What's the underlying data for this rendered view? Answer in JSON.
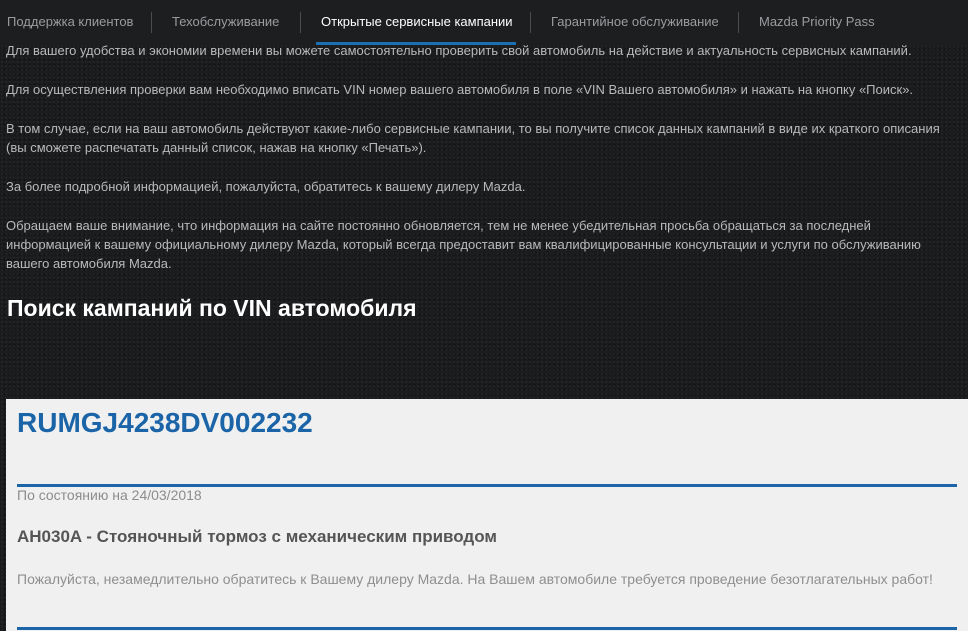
{
  "nav": {
    "tabs": [
      {
        "label": "Поддержка клиентов"
      },
      {
        "label": "Техобслуживание"
      },
      {
        "label": "Открытые сервисные кампании"
      },
      {
        "label": "Гарантийное обслуживание"
      },
      {
        "label": "Mazda Priority Pass"
      }
    ],
    "active_index": 2
  },
  "intro": {
    "paragraphs": [
      "Для вашего удобства и экономии времени вы можете самостоятельно проверить свой автомобиль на действие и актуальность сервисных кампаний.",
      "Для осуществления проверки вам необходимо вписать VIN номер вашего автомобиля в поле «VIN Вашего автомобиля» и нажать на кнопку «Поиск».",
      "В том случае, если на ваш автомобиль действуют какие-либо сервисные кампании, то вы получите список данных кампаний в виде их краткого описания (вы сможете распечатать данный список, нажав на кнопку «Печать»).",
      "За более подробной информацией, пожалуйста, обратитесь к вашему дилеру Mazda.",
      "Обращаем ваше внимание, что информация на сайте постоянно обновляется, тем не менее убедительная просьба обращаться за последней информацией к вашему официальному дилеру Mazda, который всегда предоставит вам квалифицированные консультации и услуги по обслуживанию вашего автомобиля Mazda."
    ]
  },
  "search": {
    "title": "Поиск кампаний по VIN автомобиля"
  },
  "result": {
    "vin": "RUMGJ4238DV002232",
    "status": "По состоянию на 24/03/2018",
    "campaign_title": "AH030A - Стояночный тормоз с механическим приводом",
    "campaign_description": "Пожалуйста, незамедлительно обратитесь к Вашему дилеру Mazda. На Вашем автомобиле требуется проведение безотлагательных работ!"
  },
  "colors": {
    "accent": "#1c6fb0",
    "vin_color": "#1a64a7",
    "background": "#1b1c1e",
    "card_background": "#f0f0f0"
  }
}
